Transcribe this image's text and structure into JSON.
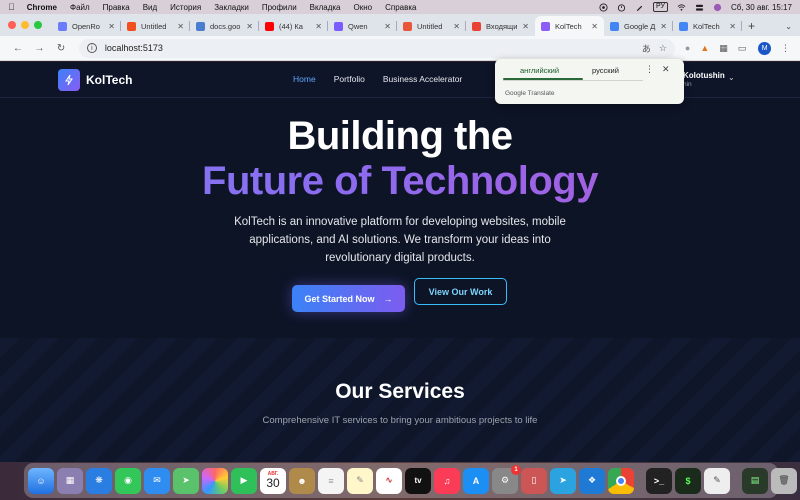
{
  "menubar": {
    "app": "Chrome",
    "items": [
      "Файл",
      "Правка",
      "Вид",
      "История",
      "Закладки",
      "Профили",
      "Вкладка",
      "Окно",
      "Справка"
    ],
    "input_source": "РУ",
    "datetime": "Сб, 30 авг.  15:17"
  },
  "tabs": [
    {
      "label": "OpenRo",
      "color": "#6b7cff",
      "active": false
    },
    {
      "label": "Untitled",
      "color": "#f24e1e",
      "active": false
    },
    {
      "label": "docs.goo",
      "color": "#4a7ccf",
      "active": false
    },
    {
      "label": "(44) Ка",
      "color": "#ff0000",
      "active": false
    },
    {
      "label": "Qwen",
      "color": "#7a5cff",
      "active": false
    },
    {
      "label": "Untitled",
      "color": "#e8553b",
      "active": false
    },
    {
      "label": "Входящи",
      "color": "#ea4335",
      "active": false
    },
    {
      "label": "KolTech",
      "color": "#8b5cf6",
      "active": true
    },
    {
      "label": "Google Д",
      "color": "#4285f4",
      "active": false
    },
    {
      "label": "KolTech",
      "color": "#4285f4",
      "active": false
    }
  ],
  "address": {
    "url": "localhost:5173"
  },
  "site": {
    "brand": "KolTech",
    "nav": [
      {
        "label": "Home",
        "active": true
      },
      {
        "label": "Portfolio",
        "active": false
      },
      {
        "label": "Business Accelerator",
        "active": false
      }
    ],
    "user_name": "Kolotushin",
    "user_sub": "hin"
  },
  "hero": {
    "title_line1": "Building the",
    "title_line2": "Future of Technology",
    "description": "KolTech is an innovative platform for developing websites, mobile applications, and AI solutions. We transform your ideas into revolutionary digital products.",
    "primary_button": "Get Started Now",
    "secondary_button": "View Our Work"
  },
  "services": {
    "title": "Our Services",
    "subtitle": "Comprehensive IT services to bring your ambitious projects to life"
  },
  "translate_popup": {
    "source_lang": "английский",
    "target_lang": "русский",
    "brand": "Google Translate"
  },
  "dock": {
    "calendar_month": "АВГ.",
    "calendar_day": "30",
    "tv_label": "tv",
    "badge": "1"
  }
}
